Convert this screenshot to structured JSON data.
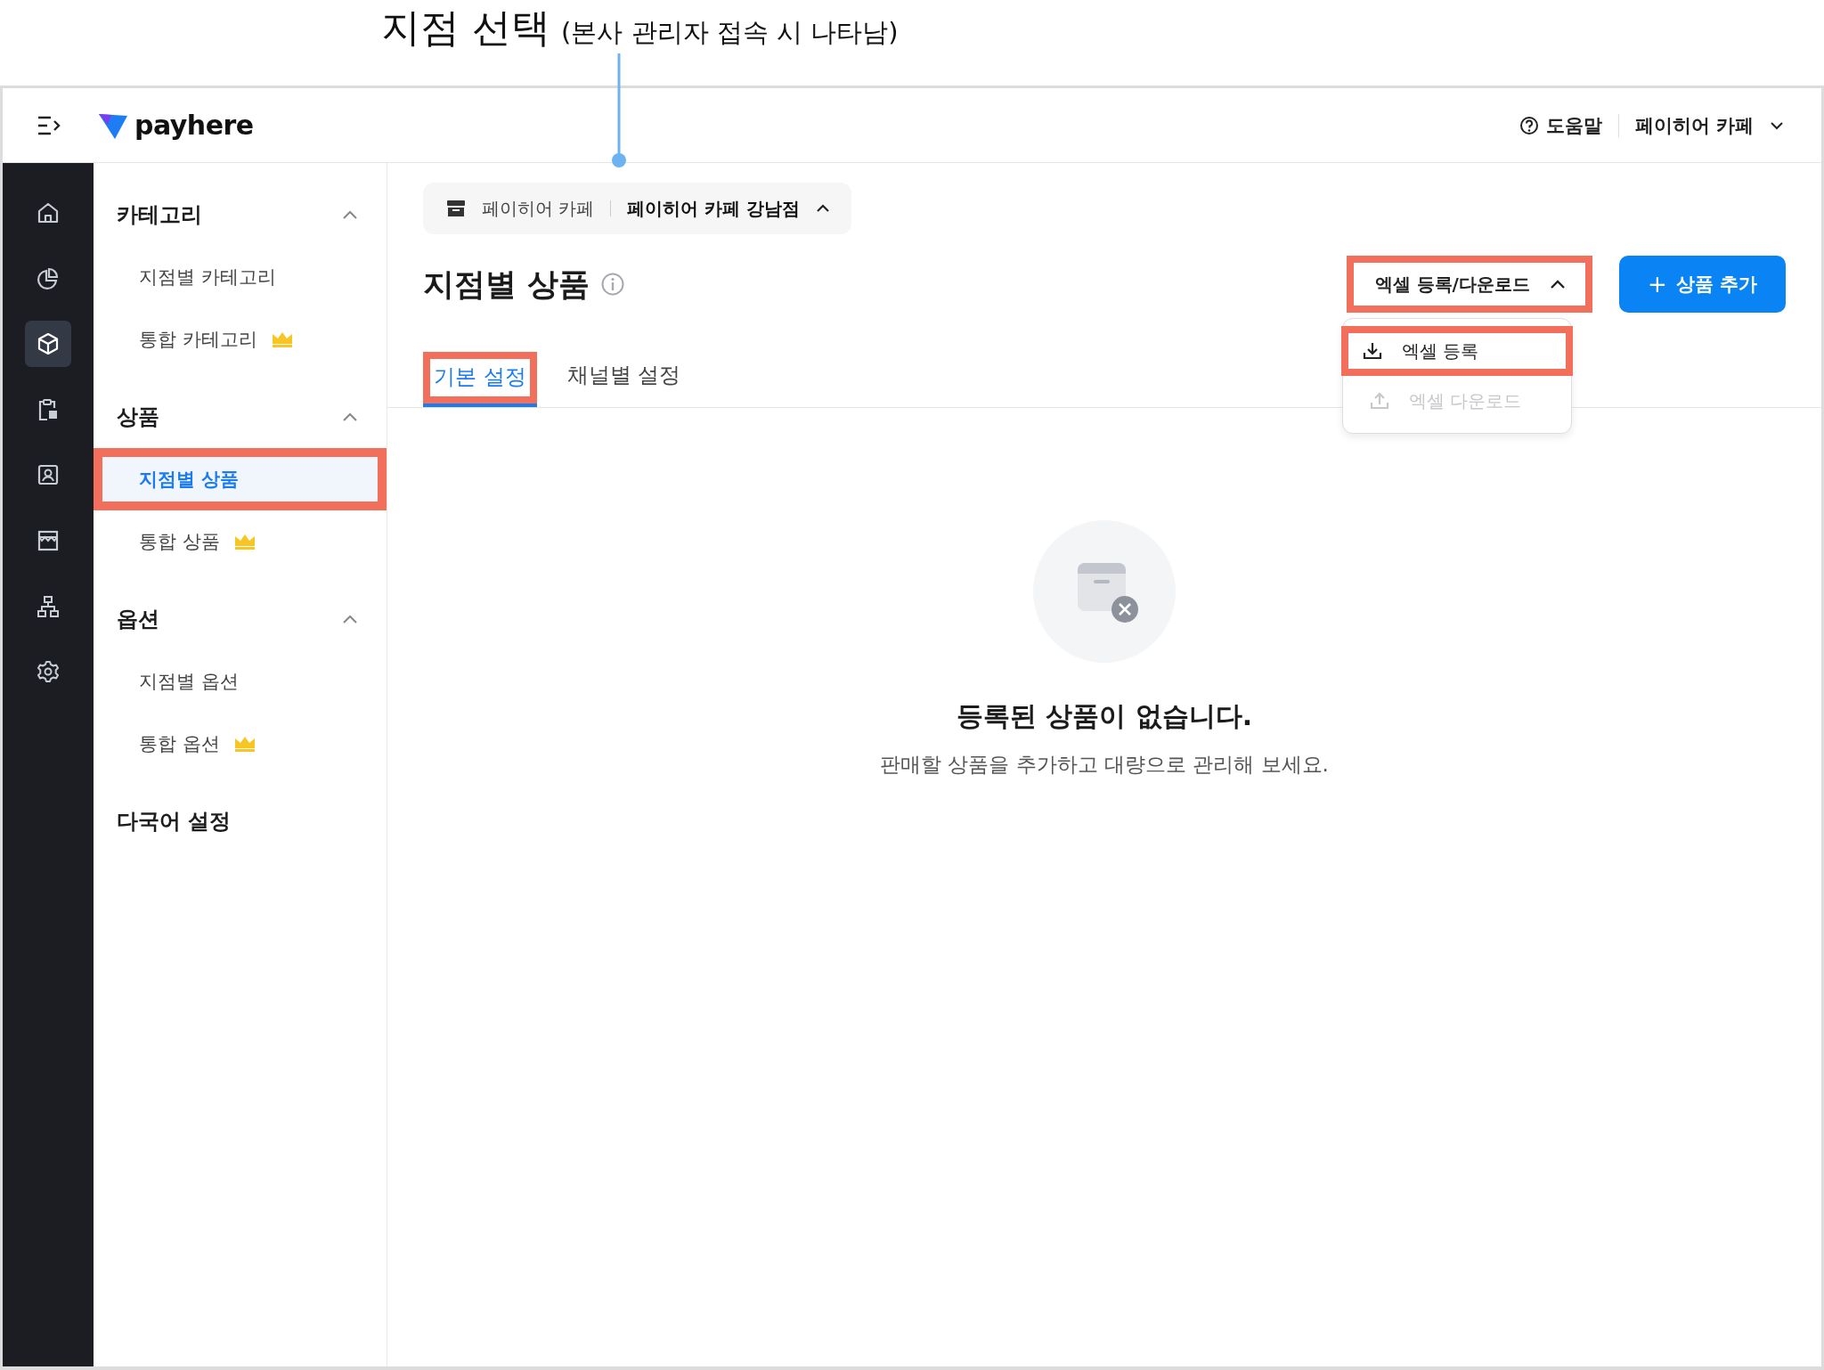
{
  "annotation": {
    "title": "지점 선택",
    "note": "(본사 관리자 접속 시 나타남)"
  },
  "header": {
    "brand": "payhere",
    "help": "도움말",
    "account": "페이히어 카페"
  },
  "rail": [
    {
      "kind": "home",
      "selected": false
    },
    {
      "kind": "chart",
      "selected": false
    },
    {
      "kind": "cube",
      "selected": true
    },
    {
      "kind": "clipboard",
      "selected": false
    },
    {
      "kind": "contact",
      "selected": false
    },
    {
      "kind": "store",
      "selected": false
    },
    {
      "kind": "sitemap",
      "selected": false
    },
    {
      "kind": "gear",
      "selected": false
    }
  ],
  "sidebar": [
    {
      "kind": "group",
      "title": "카테고리",
      "expanded": true,
      "items": [
        {
          "label": "지점별 카테고리",
          "selected": false,
          "premium": false,
          "highlighted": false
        },
        {
          "label": "통합 카테고리",
          "selected": false,
          "premium": true,
          "highlighted": false
        }
      ]
    },
    {
      "kind": "group",
      "title": "상품",
      "expanded": true,
      "items": [
        {
          "label": "지점별 상품",
          "selected": true,
          "premium": false,
          "highlighted": true
        },
        {
          "label": "통합 상품",
          "selected": false,
          "premium": true,
          "highlighted": false
        }
      ]
    },
    {
      "kind": "group",
      "title": "옵션",
      "expanded": true,
      "items": [
        {
          "label": "지점별 옵션",
          "selected": false,
          "premium": false,
          "highlighted": false
        },
        {
          "label": "통합 옵션",
          "selected": false,
          "premium": true,
          "highlighted": false
        }
      ]
    },
    {
      "kind": "link",
      "title": "다국어 설정"
    }
  ],
  "branch_selector": {
    "company": "페이히어 카페",
    "branch": "페이히어 카페 강남점",
    "expanded": true
  },
  "page_title": "지점별 상품",
  "excel_button": {
    "label": "엑셀 등록/다운로드",
    "highlighted": true,
    "expanded": true
  },
  "excel_menu": [
    {
      "kind": "import",
      "label": "엑셀 등록",
      "disabled": false,
      "highlighted": true
    },
    {
      "kind": "export",
      "label": "엑셀 다운로드",
      "disabled": true,
      "highlighted": false
    }
  ],
  "add_button": {
    "icon": "+",
    "label": "상품 추가"
  },
  "tabs": [
    {
      "label": "기본 설정",
      "selected": true,
      "highlighted": true
    },
    {
      "label": "채널별 설정",
      "selected": false,
      "highlighted": false
    }
  ],
  "empty_state": {
    "title": "등록된 상품이 없습니다.",
    "message": "판매할 상품을 추가하고 대량으로 관리해 보세요."
  }
}
